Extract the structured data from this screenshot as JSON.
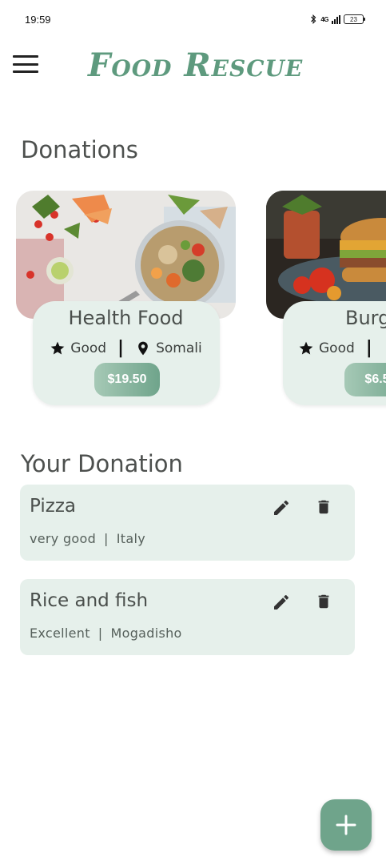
{
  "status": {
    "time": "19:59",
    "network": "4G",
    "battery": "23"
  },
  "app": {
    "title": "Food Rescue",
    "brand_color": "#5e9a7e"
  },
  "donations": {
    "title": "Donations",
    "cards": [
      {
        "name": "Health Food",
        "quality": "Good",
        "location": "Somali",
        "price": "$19.50"
      },
      {
        "name": "Burg",
        "quality": "Good",
        "location": "",
        "price": "$6.5"
      }
    ]
  },
  "your_donation": {
    "title": "Your Donation",
    "items": [
      {
        "title": "Pizza",
        "quality": "very good",
        "separator": "|",
        "location": "Italy"
      },
      {
        "title": "Rice and fish",
        "quality": "Excellent",
        "separator": "|",
        "location": "Mogadisho"
      }
    ]
  },
  "icons": {
    "menu": "menu-icon",
    "star": "star-icon",
    "location": "location-pin-icon",
    "edit": "edit-icon",
    "delete": "delete-icon",
    "add": "add-icon"
  },
  "colors": {
    "card_bg": "#e6f0eb",
    "accent": "#6fa48b"
  }
}
